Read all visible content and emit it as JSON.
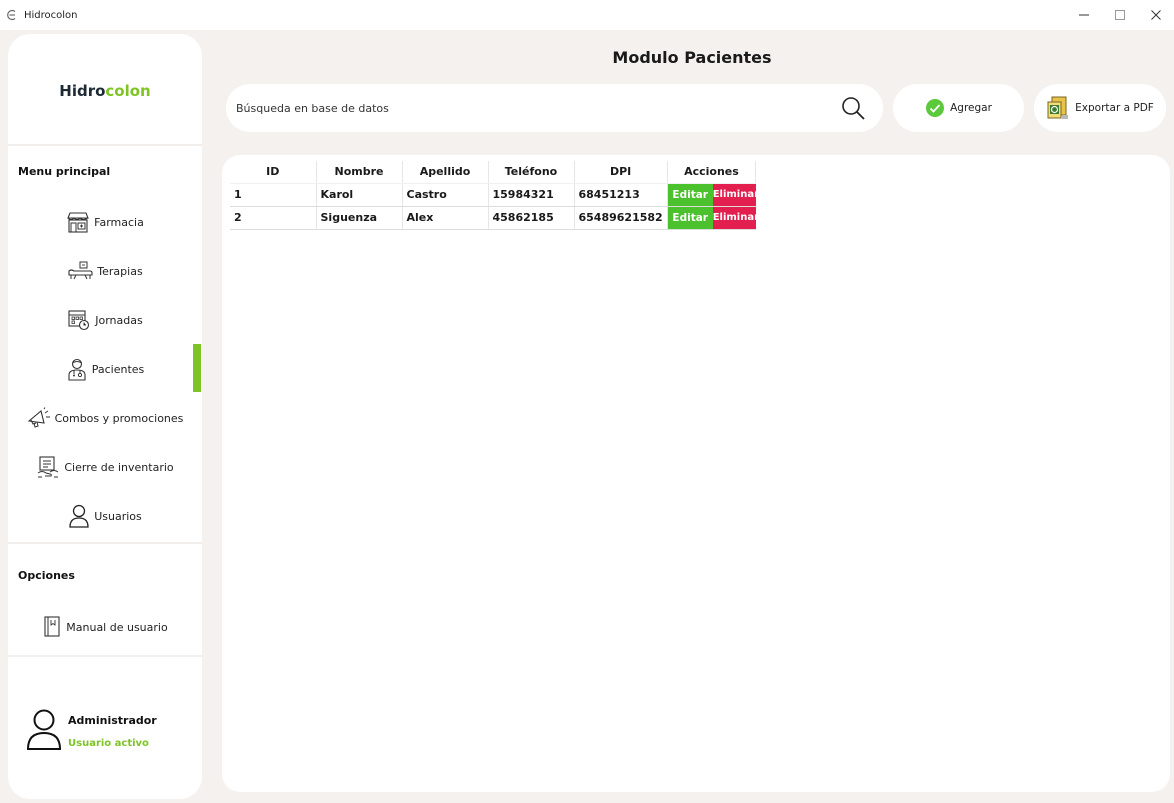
{
  "window": {
    "title": "Hidrocolon",
    "minimize_glyph": "–",
    "maximize_glyph": "□",
    "close_glyph": "✕"
  },
  "sidebar": {
    "logo_part1": "Hidro",
    "logo_part2": "colon",
    "menu_title": "Menu principal",
    "items": [
      {
        "label": "Farmacia",
        "icon": "pharmacy-icon"
      },
      {
        "label": "Terapias",
        "icon": "therapy-bed-icon"
      },
      {
        "label": "Jornadas",
        "icon": "calendar-clock-icon"
      },
      {
        "label": "Pacientes",
        "icon": "patient-icon"
      },
      {
        "label": "Combos y promociones",
        "icon": "megaphone-icon"
      },
      {
        "label": "Cierre de inventario",
        "icon": "inventory-icon"
      },
      {
        "label": "Usuarios",
        "icon": "user-icon"
      }
    ],
    "active_item": "Pacientes",
    "options_title": "Opciones",
    "options_items": [
      {
        "label": "Manual de usuario",
        "icon": "book-icon"
      }
    ],
    "user": {
      "name": "Administrador",
      "status": "Usuario activo"
    }
  },
  "header": {
    "title": "Modulo Pacientes",
    "search_placeholder": "Búsqueda en base de datos",
    "add_label": "Agregar",
    "export_label": "Exportar a PDF"
  },
  "table": {
    "columns": [
      "ID",
      "Nombre",
      "Apellido",
      "Teléfono",
      "DPI",
      "Acciones"
    ],
    "rows": [
      {
        "id": "1",
        "nombre": "Karol",
        "apellido": "Castro",
        "telefono": "15984321",
        "dpi": "68451213"
      },
      {
        "id": "2",
        "nombre": "Siguenza",
        "apellido": "Alex",
        "telefono": "45862185",
        "dpi": "65489621582"
      }
    ],
    "edit_label": "Editar",
    "delete_label": "Eliminar"
  },
  "colors": {
    "accent_green": "#7dc424",
    "edit_green": "#4cc12e",
    "delete_red": "#e21f4e",
    "background": "#f4f1ef"
  }
}
